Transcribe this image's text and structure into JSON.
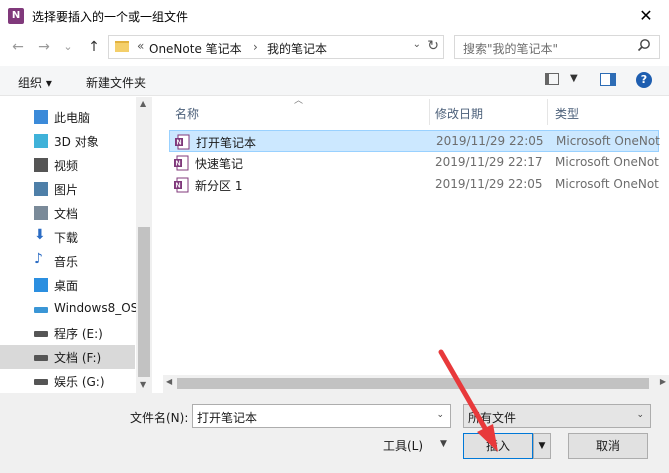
{
  "window": {
    "title": "选择要插入的一个或一组文件",
    "close_glyph": "✕"
  },
  "nav": {
    "back_glyph": "←",
    "forward_glyph": "→",
    "dropdown_glyph": "⌄",
    "up_glyph": "↑"
  },
  "address": {
    "overflow_glyph": "«",
    "crumbs": [
      "OneNote 笔记本",
      "我的笔记本"
    ],
    "separator": "›",
    "refresh_glyph": "↻"
  },
  "search": {
    "placeholder": "搜索\"我的笔记本\"",
    "icon": "search-icon"
  },
  "toolbar": {
    "organize_label": "组织 ▾",
    "new_folder_label": "新建文件夹",
    "help_label": "?"
  },
  "sidebar": {
    "items": [
      {
        "label": "此电脑",
        "icon": "computer-icon",
        "color": "#3b8ad9"
      },
      {
        "label": "3D 对象",
        "icon": "cube-icon",
        "color": "#3fb2d9"
      },
      {
        "label": "视频",
        "icon": "film-icon",
        "color": "#555555"
      },
      {
        "label": "图片",
        "icon": "picture-icon",
        "color": "#4e7fa8"
      },
      {
        "label": "文档",
        "icon": "document-icon",
        "color": "#7a8a99"
      },
      {
        "label": "下载",
        "icon": "download-icon",
        "color": "#2b6cc4"
      },
      {
        "label": "音乐",
        "icon": "music-icon",
        "color": "#2b6cc4"
      },
      {
        "label": "桌面",
        "icon": "desktop-icon",
        "color": "#2b8fe0"
      },
      {
        "label": "Windows8_OS",
        "icon": "drive-icon",
        "color": "#3a96d6"
      },
      {
        "label": "程序 (E:)",
        "icon": "drive-icon",
        "color": "#555555"
      },
      {
        "label": "文档 (F:)",
        "icon": "drive-icon",
        "color": "#555555",
        "selected": true
      },
      {
        "label": "娱乐 (G:)",
        "icon": "drive-icon",
        "color": "#555555"
      }
    ]
  },
  "columns": {
    "name": "名称",
    "date": "修改日期",
    "type": "类型"
  },
  "files": [
    {
      "name": "打开笔记本",
      "date": "2019/11/29 22:05",
      "type": "Microsoft OneNote",
      "selected": true
    },
    {
      "name": "快速笔记",
      "date": "2019/11/29 22:17",
      "type": "Microsoft OneNote",
      "selected": false
    },
    {
      "name": "新分区 1",
      "date": "2019/11/29 22:05",
      "type": "Microsoft OneNote",
      "selected": false
    }
  ],
  "bottom": {
    "filename_label": "文件名(N):",
    "filename_value": "打开笔记本",
    "filetype_value": "所有文件",
    "tools_label": "工具(L)",
    "insert_label": "插入",
    "cancel_label": "取消",
    "dropdown_glyph": "▼"
  },
  "colors": {
    "accent": "#0078d7",
    "selection": "#cce8ff",
    "annotation_arrow": "#e8393b",
    "onenote": "#80397b"
  }
}
